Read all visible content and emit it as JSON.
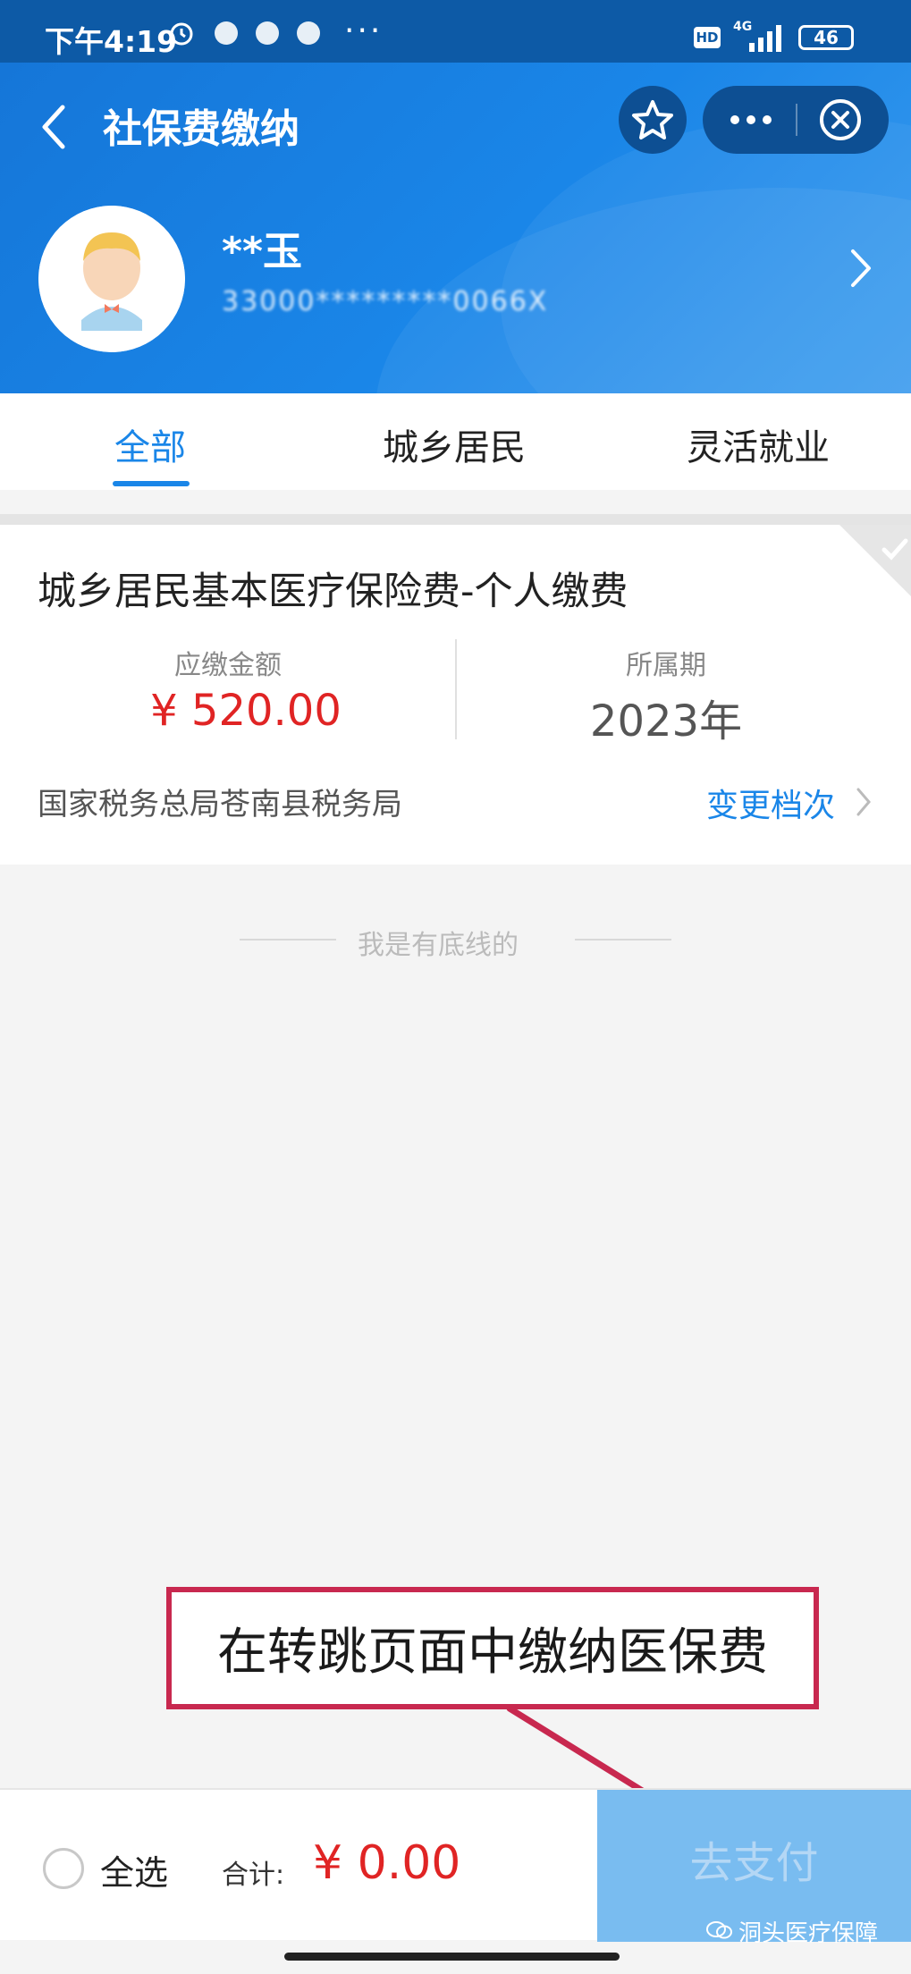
{
  "status_bar": {
    "time": "下午4:19",
    "more": "···",
    "network_hd": "HD",
    "network_type": "4G",
    "battery": "46"
  },
  "header": {
    "title": "社保费缴纳",
    "user": {
      "name": "**玉",
      "id_masked": "33000*********0066X"
    }
  },
  "tabs": [
    {
      "label": "全部",
      "active": true
    },
    {
      "label": "城乡居民",
      "active": false
    },
    {
      "label": "灵活就业",
      "active": false
    }
  ],
  "card": {
    "title": "城乡居民基本医疗保险费-个人缴费",
    "amount_label": "应缴金额",
    "amount_value": "¥ 520.00",
    "period_label": "所属期",
    "period_value": "2023年",
    "tax_office": "国家税务总局苍南县税务局",
    "change_label": "变更档次"
  },
  "bottom_line_text": "我是有底线的",
  "annotation": {
    "text": "在转跳页面中缴纳医保费"
  },
  "footer": {
    "select_all": "全选",
    "total_label": "合计:",
    "total_value": "¥ 0.00",
    "pay_button": "去支付"
  },
  "watermark": "洞头医疗保障",
  "colors": {
    "primary": "#1a86e8",
    "header_dark": "#0d4f93",
    "price_red": "#e02424",
    "pay_button": "#79bcf0",
    "annotation_border": "#c8284f"
  }
}
